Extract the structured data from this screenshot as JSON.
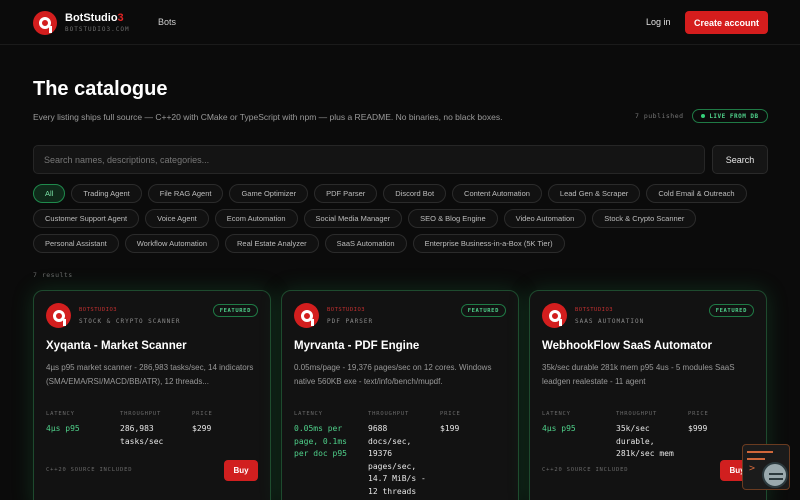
{
  "header": {
    "brand_name": "BotStudio",
    "brand_accent": "3",
    "brand_sub": "BOTSTUDIO3.COM",
    "nav_bots": "Bots",
    "login": "Log in",
    "create_account": "Create account"
  },
  "hero": {
    "title": "The catalogue",
    "subtitle": "Every listing ships full source — C++20 with CMake or TypeScript with npm — plus a README. No binaries, no black boxes.",
    "published": "7 published",
    "live_badge": "LIVE FROM DB"
  },
  "search": {
    "placeholder": "Search names, descriptions, categories...",
    "value": "",
    "button": "Search"
  },
  "categories": {
    "c0": "All",
    "c1": "Trading Agent",
    "c2": "File RAG Agent",
    "c3": "Game Optimizer",
    "c4": "PDF Parser",
    "c5": "Discord Bot",
    "c6": "Content Automation",
    "c7": "Lead Gen & Scraper",
    "c8": "Cold Email & Outreach",
    "c9": "Customer Support Agent",
    "c10": "Voice Agent",
    "c11": "Ecom Automation",
    "c12": "Social Media Manager",
    "c13": "SEO & Blog Engine",
    "c14": "Video Automation",
    "c15": "Stock & Crypto Scanner",
    "c16": "Personal Assistant",
    "c17": "Workflow Automation",
    "c18": "Real Estate Analyzer",
    "c19": "SaaS Automation",
    "c20": "Enterprise Business-in-a-Box (5K Tier)"
  },
  "results_count": "7 results",
  "cards": [
    {
      "vendor": "BOTSTUDIO3",
      "category": "STOCK & CRYPTO SCANNER",
      "featured": "FEATURED",
      "name": "Xyqanta - Market Scanner",
      "description": "4µs p95 market scanner - 286,983 tasks/sec, 14 indicators (SMA/EMA/RSI/MACD/BB/ATR), 12 threads...",
      "latency_label": "LATENCY",
      "latency": "4µs p95",
      "throughput_label": "THROUGHPUT",
      "throughput": "286,983 tasks/sec",
      "price_label": "PRICE",
      "price": "$299",
      "source": "C++20 SOURCE INCLUDED",
      "buy": "Buy"
    },
    {
      "vendor": "BOTSTUDIO3",
      "category": "PDF PARSER",
      "featured": "FEATURED",
      "name": "Myrvanta - PDF Engine",
      "description": "0.05ms/page - 19,376 pages/sec on 12 cores. Windows native 560KB exe - text/info/bench/mupdf.",
      "latency_label": "LATENCY",
      "latency": "0.05ms per page, 0.1ms per doc p95",
      "throughput_label": "THROUGHPUT",
      "throughput": "9688 docs/sec, 19376 pages/sec, 14.7 MiB/s - 12 threads",
      "price_label": "PRICE",
      "price": "$199",
      "source": "",
      "buy": ""
    },
    {
      "vendor": "BOTSTUDIO3",
      "category": "SAAS AUTOMATION",
      "featured": "FEATURED",
      "name": "WebhookFlow SaaS Automator",
      "description": "35k/sec durable 281k mem p95 4us - 5 modules SaaS leadgen realestate - 11 agent",
      "latency_label": "LATENCY",
      "latency": "4µs p95",
      "throughput_label": "THROUGHPUT",
      "throughput": "35k/sec durable, 281k/sec mem",
      "price_label": "PRICE",
      "price": "$999",
      "source": "C++20 SOURCE INCLUDED",
      "buy": "Buy"
    }
  ],
  "colors": {
    "accent_red": "#d51d1d",
    "accent_green": "#4fd08a",
    "background": "#0b0b0b"
  },
  "icons": {
    "brand": "botstudio-logo-icon",
    "assistant": "assistant-widget-icon"
  }
}
